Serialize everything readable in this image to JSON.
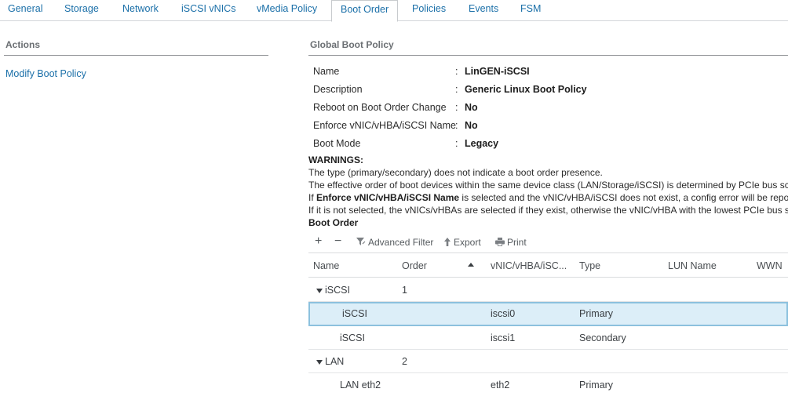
{
  "tabs": [
    {
      "label": "General"
    },
    {
      "label": "Storage"
    },
    {
      "label": "Network"
    },
    {
      "label": "iSCSI vNICs"
    },
    {
      "label": "vMedia Policy"
    },
    {
      "label": "Boot Order",
      "active": true
    },
    {
      "label": "Policies"
    },
    {
      "label": "Events"
    },
    {
      "label": "FSM"
    }
  ],
  "actions": {
    "title": "Actions",
    "modify_link": "Modify Boot Policy"
  },
  "global_boot_policy": {
    "title": "Global Boot Policy",
    "properties": [
      {
        "label": "Name",
        "value": "LinGEN-iSCSI"
      },
      {
        "label": "Description",
        "value": "Generic Linux Boot Policy"
      },
      {
        "label": "Reboot on Boot Order Change",
        "value": "No"
      },
      {
        "label": "Enforce vNIC/vHBA/iSCSI Name",
        "value": "No"
      },
      {
        "label": "Boot Mode",
        "value": "Legacy"
      }
    ],
    "colon": ":"
  },
  "warnings": {
    "title": "WARNINGS:",
    "line1": "The type (primary/secondary) does not indicate a boot order presence.",
    "line2": "The effective order of boot devices within the same device class (LAN/Storage/iSCSI) is determined by PCIe bus scan order.",
    "line3_pre": "If ",
    "line3_bold": "Enforce vNIC/vHBA/iSCSI Name",
    "line3_post": " is selected and the vNIC/vHBA/iSCSI does not exist, a config error will be reported.",
    "line4": "If it is not selected, the vNICs/vHBAs are selected if they exist, otherwise the vNIC/vHBA with the lowest PCIe bus scan order is used."
  },
  "boot_order": {
    "title": "Boot Order",
    "toolbar": {
      "add": "+",
      "remove": "−",
      "filter_label": "Advanced Filter",
      "export_label": "Export",
      "print_label": "Print"
    },
    "columns": [
      "Name",
      "Order",
      "vNIC/vHBA/iSC...",
      "Type",
      "LUN Name",
      "WWN"
    ],
    "rows": [
      {
        "name": "iSCSI",
        "order": "1",
        "vnic": "",
        "type": "",
        "group": true
      },
      {
        "name": "iSCSI",
        "order": "",
        "vnic": "iscsi0",
        "type": "Primary",
        "selected": true
      },
      {
        "name": "iSCSI",
        "order": "",
        "vnic": "iscsi1",
        "type": "Secondary"
      },
      {
        "name": "LAN",
        "order": "2",
        "vnic": "",
        "type": "",
        "group": true
      },
      {
        "name": "LAN eth2",
        "order": "",
        "vnic": "eth2",
        "type": "Primary"
      }
    ]
  },
  "colors": {
    "link": "#1a6fa8",
    "selected_row_bg": "#dceef8",
    "selected_row_border": "#8cc1de"
  }
}
